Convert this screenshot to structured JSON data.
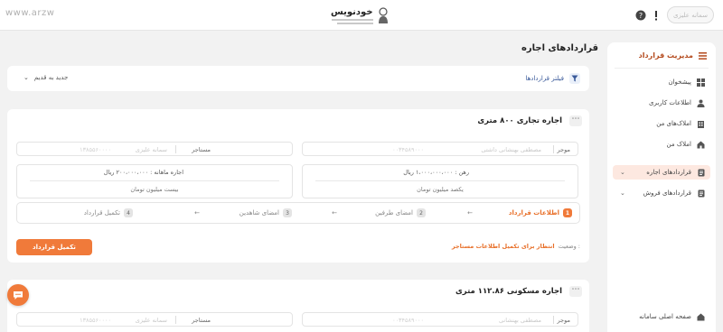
{
  "watermark": "www.arzw",
  "header": {
    "logo_title": "خودنویس",
    "help_icon": "question-icon",
    "alert_icon": "exclamation-icon",
    "user_label": "سمانه علیزی"
  },
  "sidebar": {
    "title": "مدیریت قرارداد",
    "items": [
      {
        "label": "پیشخوان",
        "icon": "dashboard-icon"
      },
      {
        "label": "اطلاعات کاربری",
        "icon": "user-icon"
      },
      {
        "label": "املاک‌های من",
        "icon": "building-icon"
      },
      {
        "label": "املاک من",
        "icon": "home-icon"
      },
      {
        "label": "قراردادهای اجاره",
        "icon": "document-icon"
      },
      {
        "label": "قراردادهای فروش",
        "icon": "document-icon"
      }
    ],
    "footer": "صفحه اصلی سامانه"
  },
  "page": {
    "title": "قراردادهای اجاره",
    "filter_label": "فیلتر قراردادها",
    "sort_label": "جدید به قدیم"
  },
  "cards": [
    {
      "title": "اجاره تجاری ۸۰۰ متری",
      "landlord_label": "موجر",
      "landlord_name": "مصطفی بهنشانی داشتی",
      "landlord_code": "۰۰۳۴۵۸۹۰۰۰",
      "tenant_label": "مستاجر",
      "tenant_name": "سمانه علیزی",
      "tenant_code": "۱۳۸۵۵۶۰۰۰۰",
      "deposit_line": "رهن : ۱،۰۰۰،۰۰۰،۰۰۰ ریال",
      "deposit_words": "یکصد میلیون تومان",
      "rent_line": "اجاره ماهانه : ۲۰۰،۰۰۰،۰۰۰ ریال",
      "rent_words": "بیست میلیون تومان",
      "steps": [
        {
          "num": "1",
          "label": "اطلاعات قرارداد"
        },
        {
          "num": "2",
          "label": "امضای طرفین"
        },
        {
          "num": "3",
          "label": "امضای شاهدین"
        },
        {
          "num": "4",
          "label": "تکمیل قرارداد"
        }
      ],
      "status_label": "وضعیت :",
      "status_value": "انتظار برای تکمیل اطلاعات مستاجر",
      "complete_button": "تکمیل قرارداد"
    },
    {
      "title": "اجاره مسکونی ۱۱۲.۸۶ متری",
      "landlord_label": "موجر",
      "landlord_name": "مصطفی بهنشانی",
      "landlord_code": "۰۰۳۴۵۸۹۰۰۰",
      "tenant_label": "مستاجر",
      "tenant_name": "سمانه علیزی",
      "tenant_code": "۱۳۸۵۵۶۰۰۰۰"
    }
  ],
  "colors": {
    "accent": "#f07a3a",
    "accent_dark": "#b44a1d",
    "filter_blue": "#3a5a9a"
  }
}
